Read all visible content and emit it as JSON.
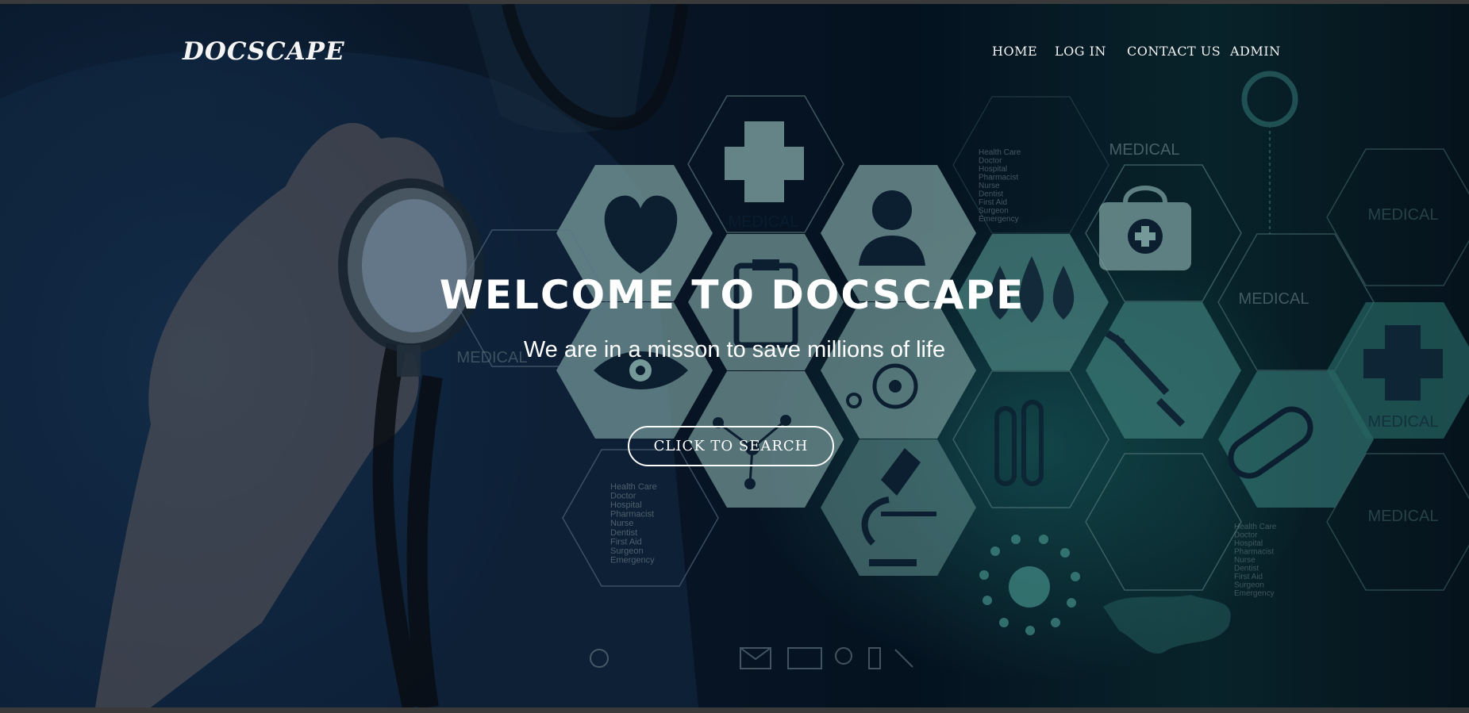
{
  "brand": {
    "name": "DOCSCAPE"
  },
  "nav": {
    "items": [
      {
        "label": "HOME"
      },
      {
        "label": "LOG IN"
      },
      {
        "label": "CONTACT US"
      },
      {
        "label": "ADMIN"
      }
    ]
  },
  "hero": {
    "title": "WELCOME TO DOCSCAPE",
    "subtitle": "We are in a misson to save millions of life",
    "cta_label": "CLICK TO SEARCH"
  },
  "background": {
    "hex_labels": [
      "MEDICAL",
      "MEDICAL",
      "MEDICAL",
      "MEDICAL",
      "MEDICAL",
      "MEDICAL",
      "MEDICAL"
    ],
    "service_list": [
      "Health Care",
      "Doctor",
      "Hospital",
      "Pharmacist",
      "Nurse",
      "Dentist",
      "First Aid",
      "Surgeon",
      "Emergency"
    ]
  },
  "colors": {
    "text": "#ffffff",
    "backdrop_navy": "#0b1a2c",
    "accent_teal": "#2a9a8e",
    "hex_fill": "#8fb9b7"
  },
  "icons": [
    "stethoscope-image",
    "medical-cross-icon",
    "heart-icon",
    "person-icon",
    "clipboard-icon",
    "drops-icon",
    "first-aid-kit-icon",
    "eye-icon",
    "wheelchair-icon",
    "syringe-icon",
    "test-tubes-icon",
    "molecule-icon",
    "microscope-icon",
    "pill-icon",
    "virus-icon",
    "world-map-icon",
    "power-icon",
    "mail-icon",
    "monitor-icon",
    "tools-icon"
  ]
}
